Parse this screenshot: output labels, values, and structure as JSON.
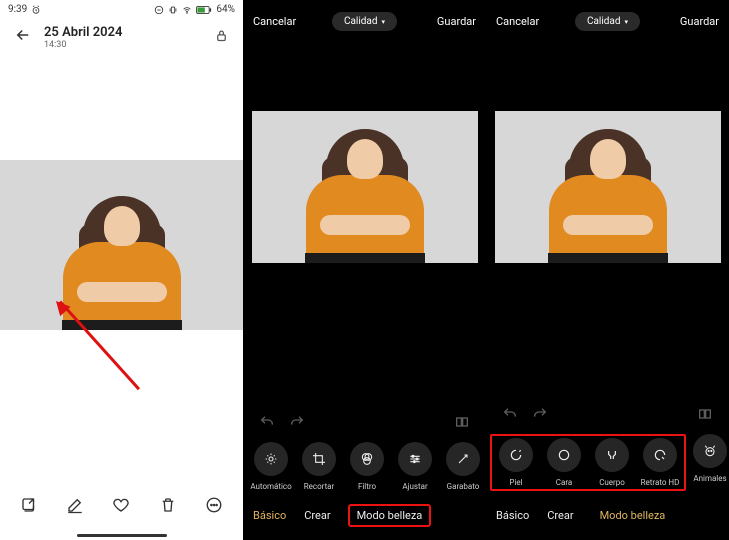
{
  "left": {
    "status": {
      "time": "9:39",
      "battery": "64%"
    },
    "date": "25 Abril 2024",
    "time": "14:30"
  },
  "editor": {
    "cancel": "Cancelar",
    "quality": "Calidad",
    "save": "Guardar"
  },
  "tools_mid": [
    {
      "name": "auto",
      "label": "Automático"
    },
    {
      "name": "crop",
      "label": "Recortar"
    },
    {
      "name": "filter",
      "label": "Filtro"
    },
    {
      "name": "adjust",
      "label": "Ajustar"
    },
    {
      "name": "doodle",
      "label": "Garabato"
    }
  ],
  "tools_right": [
    {
      "name": "skin",
      "label": "Piel"
    },
    {
      "name": "face",
      "label": "Cara"
    },
    {
      "name": "body",
      "label": "Cuerpo"
    },
    {
      "name": "portrait-hd",
      "label": "Retrato HD"
    },
    {
      "name": "animals",
      "label": "Animales"
    }
  ],
  "modes": {
    "basic": "Básico",
    "create": "Crear",
    "beauty": "Modo belleza"
  }
}
